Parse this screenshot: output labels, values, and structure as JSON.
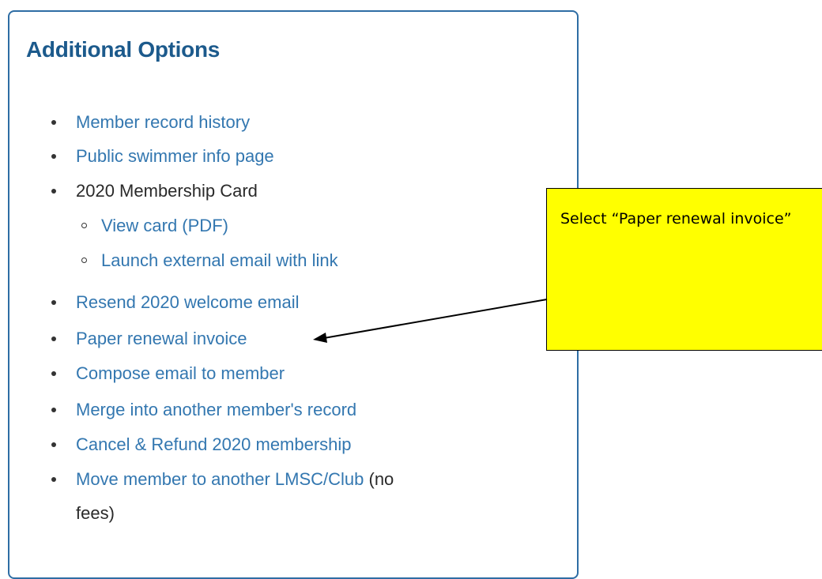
{
  "panel": {
    "title": "Additional Options",
    "items": [
      {
        "label": "Member record history",
        "link": true
      },
      {
        "label": "Public swimmer info page",
        "link": true
      },
      {
        "label": "2020 Membership Card",
        "link": false
      },
      {
        "label": "View card (PDF)",
        "link": true,
        "sub": true
      },
      {
        "label": "Launch external email with link",
        "link": true,
        "sub": true
      },
      {
        "label": "Resend 2020 welcome email",
        "link": true
      },
      {
        "label": "Paper renewal invoice",
        "link": true
      },
      {
        "label": "Compose email to member",
        "link": true
      },
      {
        "label": "Merge into another member's record",
        "link": true
      },
      {
        "label": "Cancel & Refund 2020 membership",
        "link": true
      },
      {
        "label": "Move member to another LMSC/Club",
        "link": true,
        "suffix": "(no",
        "continuation": "fees)"
      }
    ]
  },
  "callout": {
    "text": "Select “Paper renewal invoice”"
  },
  "colors": {
    "link": "#3377b0",
    "title": "#1c5a8c",
    "border": "#2e6da4",
    "callout_bg": "#ffff00"
  }
}
